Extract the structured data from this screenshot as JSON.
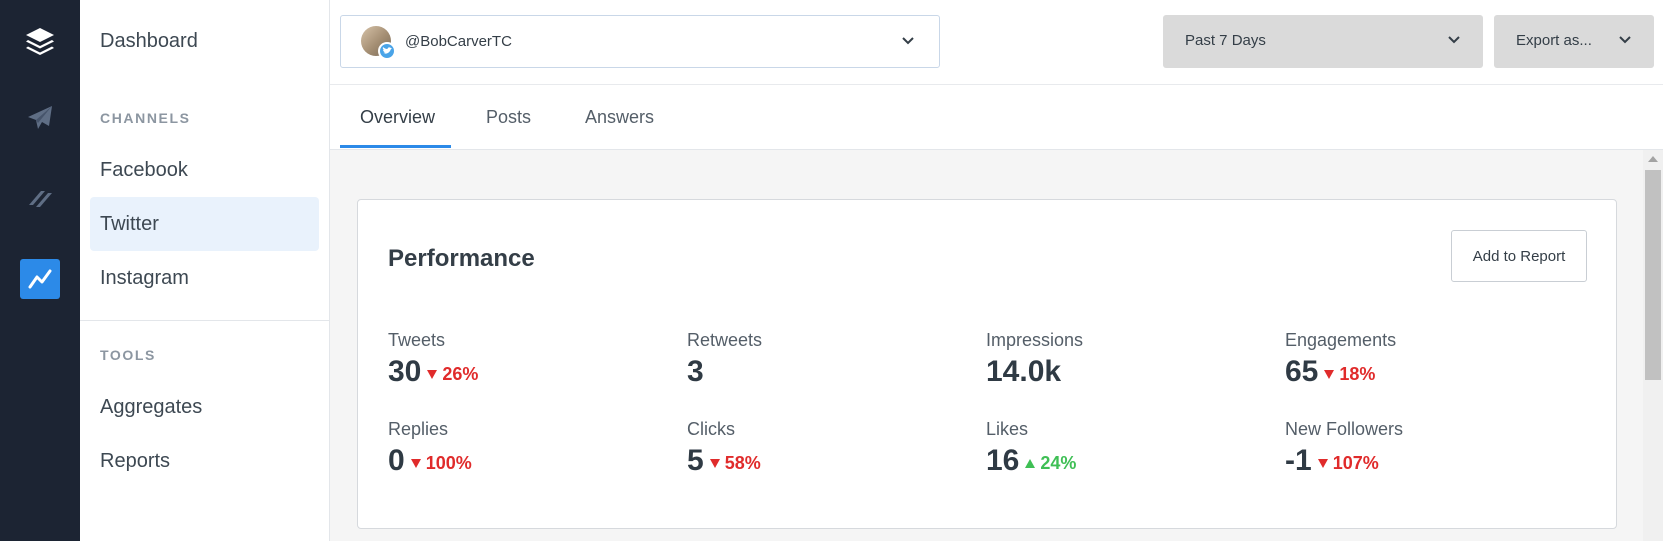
{
  "rail": {
    "items": [
      {
        "icon": "buffer-logo-icon"
      },
      {
        "icon": "paper-plane-icon"
      },
      {
        "icon": "reply-icon"
      },
      {
        "icon": "analytics-line-icon",
        "active": true
      }
    ]
  },
  "sidebar": {
    "dashboard": "Dashboard",
    "channels_heading": "CHANNELS",
    "channels": [
      "Facebook",
      "Twitter",
      "Instagram"
    ],
    "active_channel": "Twitter",
    "tools_heading": "TOOLS",
    "tools": [
      "Aggregates",
      "Reports"
    ]
  },
  "topbar": {
    "profile": "@BobCarverTC",
    "date_range": "Past 7 Days",
    "export": "Export as..."
  },
  "tabs": [
    "Overview",
    "Posts",
    "Answers"
  ],
  "active_tab": "Overview",
  "performance": {
    "title": "Performance",
    "add_button": "Add to Report",
    "metrics": [
      {
        "label": "Tweets",
        "value": "30",
        "change": "26%",
        "direction": "down"
      },
      {
        "label": "Retweets",
        "value": "3",
        "change": "",
        "direction": ""
      },
      {
        "label": "Impressions",
        "value": "14.0k",
        "change": "",
        "direction": ""
      },
      {
        "label": "Engagements",
        "value": "65",
        "change": "18%",
        "direction": "down"
      },
      {
        "label": "Replies",
        "value": "0",
        "change": "100%",
        "direction": "down"
      },
      {
        "label": "Clicks",
        "value": "5",
        "change": "58%",
        "direction": "down"
      },
      {
        "label": "Likes",
        "value": "16",
        "change": "24%",
        "direction": "up"
      },
      {
        "label": "New Followers",
        "value": "-1",
        "change": "107%",
        "direction": "down"
      }
    ]
  },
  "colors": {
    "rail_bg": "#1c2433",
    "accent": "#2c8ae8",
    "negative": "#e02b2b",
    "positive": "#3fbf55"
  }
}
